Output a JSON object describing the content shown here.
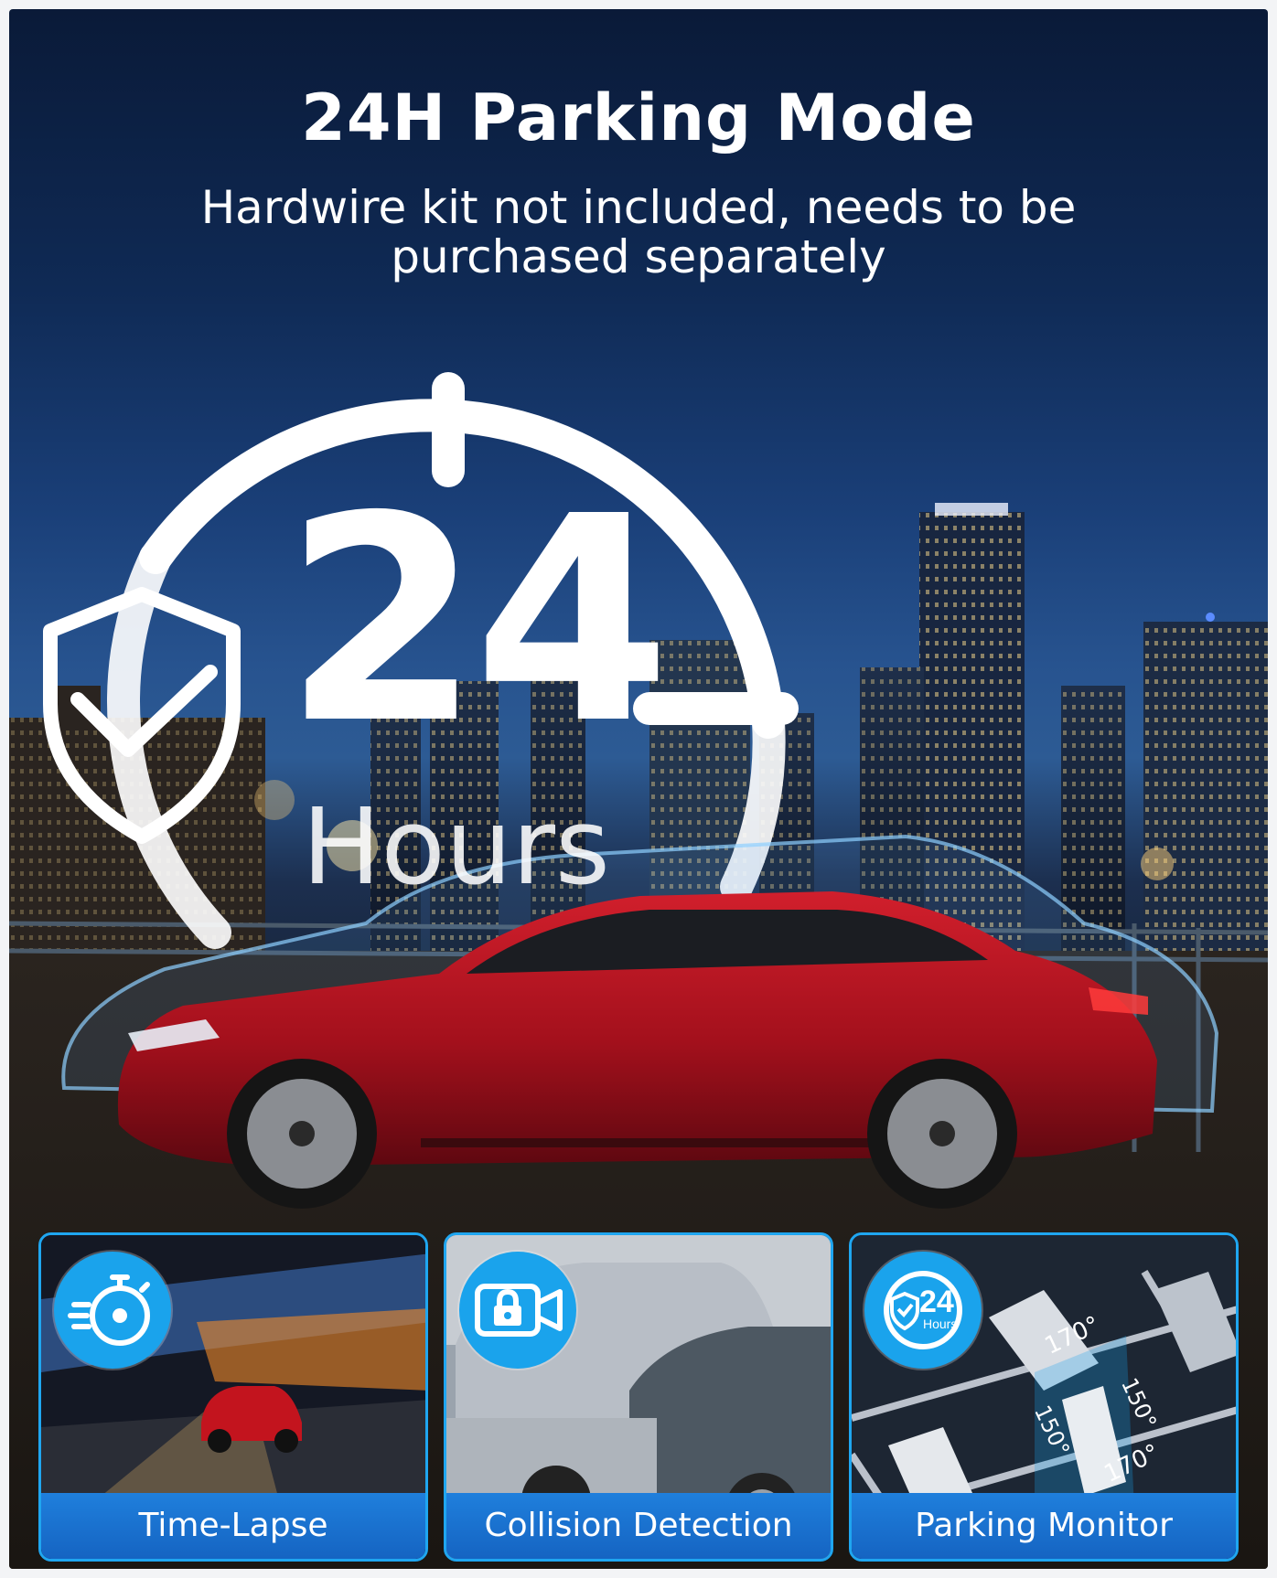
{
  "header": {
    "title": "24H Parking Mode",
    "subtitle": "Hardwire kit not included, needs to be purchased separately"
  },
  "hero": {
    "number": "24",
    "unit": "Hours"
  },
  "features": [
    {
      "label": "Time-Lapse",
      "icon": "stopwatch-icon"
    },
    {
      "label": "Collision Detection",
      "icon": "camera-lock-icon"
    },
    {
      "label": "Parking Monitor",
      "icon": "24-hours-shield-icon"
    }
  ],
  "parking_monitor": {
    "badge_number": "24",
    "badge_unit": "Hours",
    "angles": [
      "170°",
      "150°",
      "150°",
      "170°"
    ]
  },
  "colors": {
    "accent": "#1aa3ec",
    "label_bar": "#1670cc",
    "car_red": "#b3121f"
  }
}
